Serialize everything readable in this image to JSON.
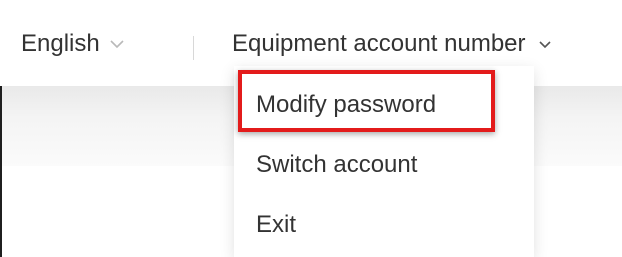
{
  "header": {
    "language_label": "English",
    "account_label": "Equipment account number"
  },
  "icons": {
    "language_dropdown": "chevron-down-icon",
    "account_dropdown": "chevron-down-icon"
  },
  "dropdown_menu": {
    "items": [
      {
        "label": "Modify password"
      },
      {
        "label": "Switch account"
      },
      {
        "label": "Exit"
      }
    ]
  },
  "colors": {
    "highlight_border": "#e31b1b",
    "text": "#333333",
    "divider": "#d8d8d8"
  }
}
